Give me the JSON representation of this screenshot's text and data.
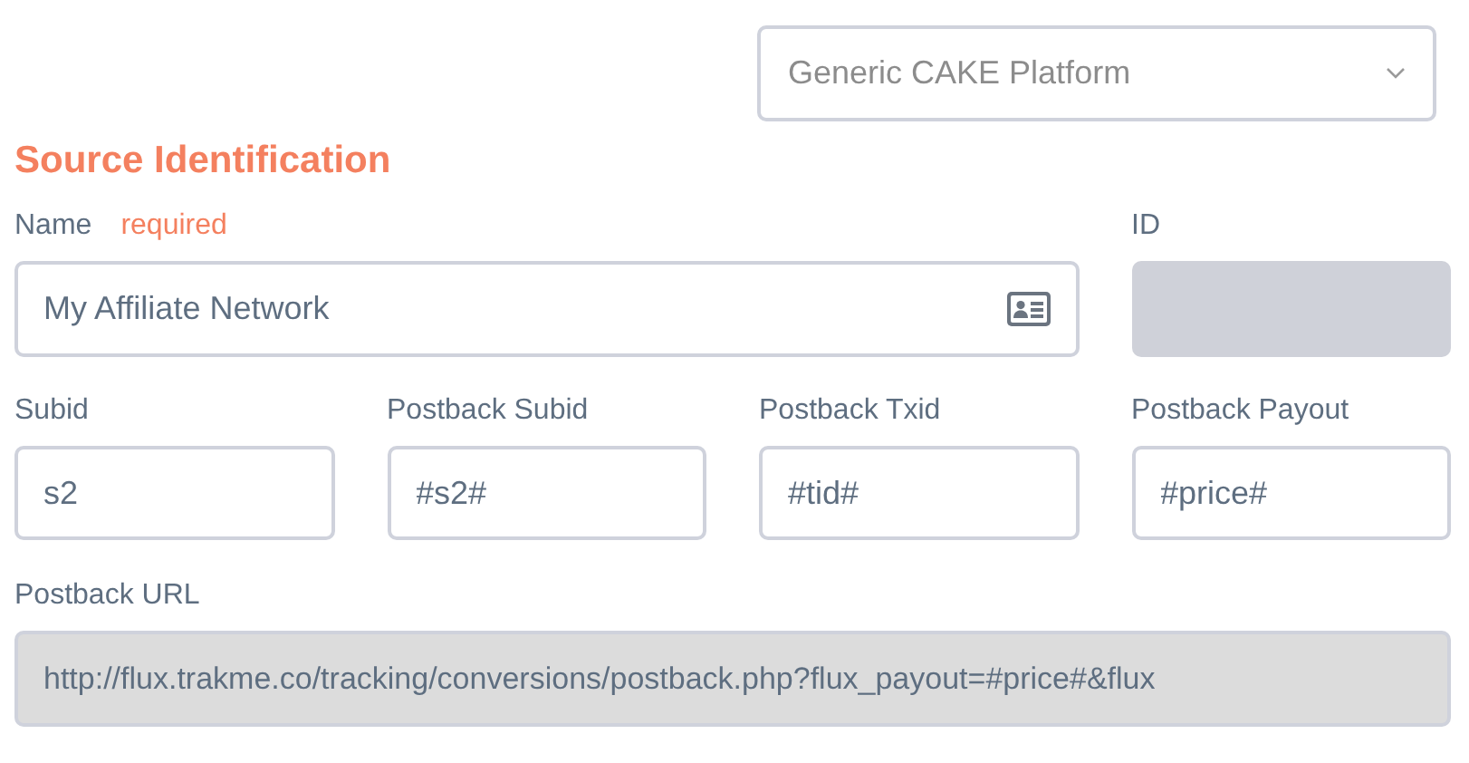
{
  "platform_select": {
    "value": "Generic CAKE Platform"
  },
  "section_title": "Source Identification",
  "name_field": {
    "label": "Name",
    "required_note": "required",
    "value": "My Affiliate Network"
  },
  "id_field": {
    "label": "ID",
    "disabled": true
  },
  "fields": [
    {
      "label": "Subid",
      "value": "s2"
    },
    {
      "label": "Postback Subid",
      "value": "#s2#"
    },
    {
      "label": "Postback Txid",
      "value": "#tid#"
    },
    {
      "label": "Postback Payout",
      "value": "#price#"
    }
  ],
  "postback_url": {
    "label": "Postback URL",
    "value": "http://flux.trakme.co/tracking/conversions/postback.php?flux_payout=#price#&flux",
    "disabled": true
  }
}
